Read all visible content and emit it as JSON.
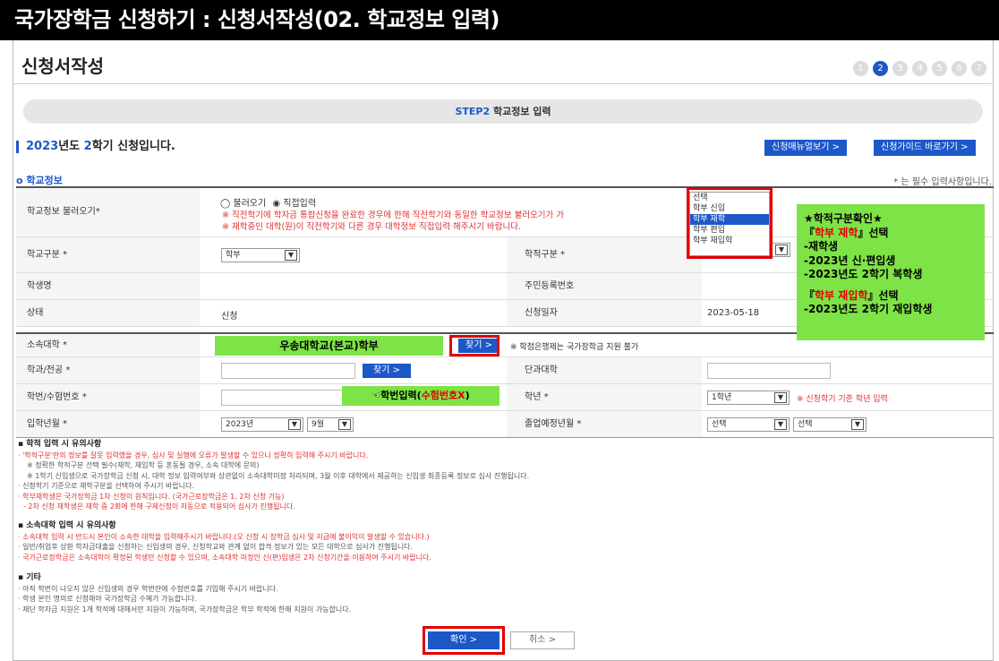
{
  "header": {
    "title": "국가장학금 신청하기 : 신청서작성(02. 학교정보 입력)"
  },
  "page": {
    "title": "신청서작성"
  },
  "steps": [
    "1",
    "2",
    "3",
    "4",
    "5",
    "6",
    "7"
  ],
  "active_step": "2",
  "stepbar": {
    "num": "STEP2",
    "label": " 학교정보 입력"
  },
  "semester": {
    "year": "2023",
    "text1": "년도 ",
    "term": "2",
    "text2": "학기 신청입니다."
  },
  "buttons": {
    "manual": "신청매뉴얼보기 >",
    "guide": "신청가이드 바로가기 >",
    "find": "찾기 >",
    "find2": "찾기 >",
    "confirm": "확인   >",
    "cancel": "취소   >"
  },
  "section": {
    "label": "o 학교정보",
    "required_note": "* 는 필수 입력사항입니다."
  },
  "form": {
    "load_label": "학교정보 불러오기*",
    "radio_load": "불러오기",
    "radio_direct": "직접입력",
    "load_note1": "※ 직전학기에 학자금 통합신청을 완료한 경우에 한해 직전학기와 동일한 학교정보 불러오기가 가",
    "load_note2": "※ 재학중인 대학(원)이 직전학기와 다른 경우 대학정보 직접입력 해주시기 바랍니다.",
    "school_type_label": "학교구분 *",
    "school_type_value": "학부",
    "academic_type_label": "학적구분 *",
    "student_name_label": "학생명",
    "rrn_label": "주민등록번호",
    "status_label": "상태",
    "status_value": "신청",
    "apply_date_label": "신청일자",
    "apply_date_value": "2023-05-18",
    "univ_label": "소속대학 *",
    "univ_note": "※ 학점은행제는 국가장학금 지원 불가",
    "dept_label": "학과/전공 *",
    "college_label": "단과대학",
    "student_no_label": "학번/수험번호 *",
    "grade_label": "학년 *",
    "grade_value": "1학년",
    "grade_note": "※ 신청학기 기준 학년 입력",
    "entry_label": "입학년월 *",
    "entry_year": "2023년",
    "entry_month": "9월",
    "grad_label": "졸업예정년월 *",
    "grad_year": "선택",
    "grad_month": "선택"
  },
  "dropdown_options": [
    "선택",
    "학부 신입",
    "학부 재학",
    "학부 편입",
    "학부 재입학"
  ],
  "dropdown_selected": "학부 재학",
  "annotations": {
    "univ": "우송대학교(본교)학부",
    "student_no_prefix": "☜학번입력(",
    "student_no_red": "수험번호X",
    "student_no_suffix": ")",
    "guide_title": "★학적구분확인★",
    "guide_line1_a": "『",
    "guide_line1_red": "학부 재학",
    "guide_line1_b": "』선택",
    "guide_line2": "-재학생",
    "guide_line3": "-2023년 신·편입생",
    "guide_line4": "-2023년도 2학기 복학생",
    "guide_line5_a": "『",
    "guide_line5_red": "학부 재입학",
    "guide_line5_b": "』선택",
    "guide_line6": "-2023년도 2학기 재입학생"
  },
  "notes": {
    "h1": "▪ 학적 입력 시 유의사항",
    "n1": "· '학적구분'란의 정보를 잘못 입력했을 경우, 심사 및 실행에 오류가 발생할 수 있으니 정확히 입력해 주시기 바랍니다.",
    "n2": "※ 정확한 학적구분 선택 필수(재학, 재입학 등 혼동될 경우, 소속 대학에 문의)",
    "n3": "※ 1학기 신입생으로 국가장학금 신청 시, 대학 정보 입력여부와 상관없이 소속대학미정 처리되며, 3월 이후 대학에서 제공하는 신입생 최종등록 정보로 심사 진행됩니다.",
    "n4": "· 신청학기 기준으로 재학구분을 선택하여 주시기 바랍니다.",
    "n5": "· 학부재학생은 국가장학금 1차 신청이 원칙입니다. (국가근로장학금은 1, 2차 신청 가능)",
    "n6": "- 2차 신청 재학생은 재학 중 2회에 한해 구제신청이 자동으로 적용되어 심사가 진행됩니다.",
    "h2": "▪ 소속대학 입력 시 유의사항",
    "n7": "· 소속대학 입력 시 반드시 본인이 소속한 대학을 입력해주시기 바랍니다.(오 신청 시 장학금 심사 및 지급에 불이익이 발생할 수 있습니다.)",
    "n8": "· 일반/취업후 상환 학자금대출을 신청하는 신입생의 경우, 신청학교와 관계 없이 합격 정보가 있는 모든 대학으로 심사가 진행됩니다.",
    "n9": "· 국가근로장학금은 소속대학이 확정된 학생만 신청할 수 있으며, 소속대학 미정인 신(편)입생은 2차 신청기간을 이용하여 주시기 바랍니다.",
    "h3": "▪ 기타",
    "n10": "· 아직 학번이 나오지 않은 신입생의 경우 학번란에 수험번호를 기입해 주시기 바랍니다.",
    "n11": "· 학생 본인 명의로 신청해야 국가장학금 수혜가 가능합니다.",
    "n12": "· 재단 학자금 지원은 1개 학적에 대해서만 지원이 가능하며, 국가장학금은 학부 학적에 한해 지원이 가능합니다."
  },
  "colors": {
    "brand_blue": "#1d58c9",
    "annotation_green": "#7ee346",
    "highlight_red": "#e00000"
  }
}
